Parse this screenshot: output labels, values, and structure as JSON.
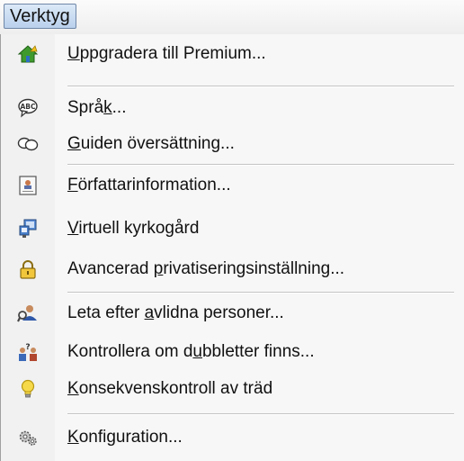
{
  "menubar": {
    "title": "Verktyg"
  },
  "menu": {
    "items": [
      {
        "pre": "",
        "key": "U",
        "post": "ppgradera till Premium...",
        "icon": "house-upgrade-icon"
      },
      {
        "pre": "Språ",
        "key": "k",
        "post": "...",
        "icon": "abc-speech-bubble-icon"
      },
      {
        "pre": "",
        "key": "G",
        "post": "uiden översättning...",
        "icon": "speech-bubbles-icon"
      },
      {
        "pre": "",
        "key": "F",
        "post": "örfattarinformation...",
        "icon": "author-card-icon"
      },
      {
        "pre": "",
        "key": "V",
        "post": "irtuell kyrkogård",
        "icon": "virtual-cemetery-icon"
      },
      {
        "pre": "Avancerad ",
        "key": "p",
        "post": "rivatiseringsinställning...",
        "icon": "padlock-icon"
      },
      {
        "pre": "Leta efter ",
        "key": "a",
        "post": "vlidna personer...",
        "icon": "search-person-icon"
      },
      {
        "pre": "Kontrollera om d",
        "key": "u",
        "post": "bbletter finns...",
        "icon": "duplicate-persons-icon"
      },
      {
        "pre": "",
        "key": "K",
        "post": "onsekvenskontroll av träd",
        "icon": "lightbulb-icon"
      },
      {
        "pre": "",
        "key": "K",
        "post": "onfiguration...",
        "icon": "gears-icon"
      }
    ]
  }
}
